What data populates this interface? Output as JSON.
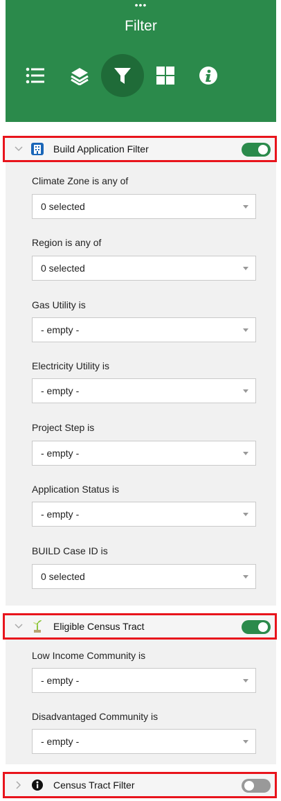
{
  "header": {
    "grip": "•••",
    "title": "Filter",
    "tools": [
      {
        "icon": "list-icon"
      },
      {
        "icon": "layers-icon"
      },
      {
        "icon": "filter-icon"
      },
      {
        "icon": "grid-icon"
      },
      {
        "icon": "info-icon"
      }
    ],
    "colors": {
      "brand": "#2b8a4b",
      "active": "#1f6b38",
      "highlight": "#e8141c"
    }
  },
  "sections": [
    {
      "label": "Build Application Filter",
      "icon": "building-icon",
      "expanded": true,
      "enabled": true,
      "fields": [
        {
          "label": "Climate Zone is any of",
          "value": "0 selected"
        },
        {
          "label": "Region is any of",
          "value": "0 selected"
        },
        {
          "label": "Gas Utility is",
          "value": "- empty -"
        },
        {
          "label": "Electricity Utility is",
          "value": "- empty -"
        },
        {
          "label": "Project Step is",
          "value": "- empty -"
        },
        {
          "label": "Application Status is",
          "value": "- empty -"
        },
        {
          "label": "BUILD Case ID is",
          "value": "0 selected"
        }
      ]
    },
    {
      "label": "Eligible Census Tract",
      "icon": "sprout-icon",
      "expanded": true,
      "enabled": true,
      "fields": [
        {
          "label": "Low Income Community is",
          "value": "- empty -"
        },
        {
          "label": "Disadvantaged Community is",
          "value": "- empty -"
        }
      ]
    },
    {
      "label": "Census Tract Filter",
      "icon": "info-circle-icon",
      "expanded": false,
      "enabled": false,
      "fields": []
    }
  ]
}
